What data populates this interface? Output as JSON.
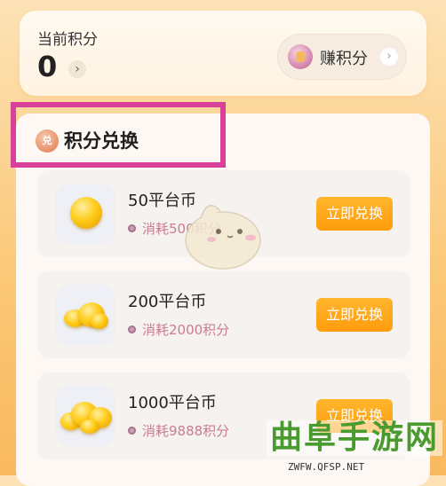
{
  "points": {
    "label": "当前积分",
    "value": "0",
    "chevron": "›"
  },
  "earn": {
    "label": "赚积分",
    "chevron": "›",
    "icon": "points-coin-icon"
  },
  "section": {
    "icon_text": "兑",
    "title": "积分兑换"
  },
  "items": [
    {
      "name": "50平台币",
      "cost": "消耗500积分",
      "button": "立即兑换"
    },
    {
      "name": "200平台币",
      "cost": "消耗2000积分",
      "button": "立即兑换"
    },
    {
      "name": "1000平台币",
      "cost": "消耗9888积分",
      "button": "立即兑换"
    }
  ],
  "watermark": {
    "title": "曲阜手游网",
    "url": "ZWFW.QFSP.NET"
  },
  "colors": {
    "accent_orange": "#ff9c0c",
    "highlight_magenta": "#d8409a",
    "cost_pink": "#ca7c94",
    "watermark_green": "#4a9b2f"
  }
}
